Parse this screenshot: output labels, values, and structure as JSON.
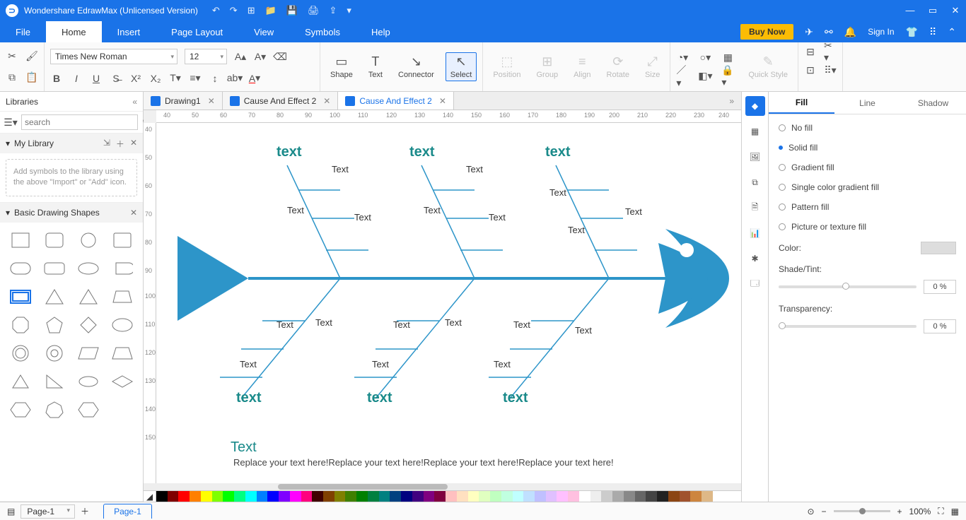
{
  "titlebar": {
    "app": "Wondershare EdrawMax (Unlicensed Version)"
  },
  "menu": {
    "items": [
      "File",
      "Home",
      "Insert",
      "Page Layout",
      "View",
      "Symbols",
      "Help"
    ],
    "active": 1,
    "buy": "Buy Now",
    "signin": "Sign In"
  },
  "ribbon": {
    "font": "Times New Roman",
    "size": "12",
    "tools": {
      "shape": "Shape",
      "text": "Text",
      "connector": "Connector",
      "select": "Select",
      "position": "Position",
      "group": "Group",
      "align": "Align",
      "rotate": "Rotate",
      "sizeb": "Size",
      "quick": "Quick Style"
    }
  },
  "left": {
    "title": "Libraries",
    "search_ph": "search",
    "mylib": "My Library",
    "note": "Add symbols to the library using the above \"Import\" or \"Add\" icon.",
    "shapes": "Basic Drawing Shapes"
  },
  "tabs": [
    {
      "label": "Drawing1",
      "active": false
    },
    {
      "label": "Cause And Effect 2",
      "active": false
    },
    {
      "label": "Cause And Effect 2",
      "active": true
    }
  ],
  "diagram": {
    "categories_top": [
      "text",
      "text",
      "text"
    ],
    "categories_bot": [
      "text",
      "text",
      "text"
    ],
    "sub": "Text",
    "title": "Text",
    "desc": "Replace your text here!Replace your text here!Replace your text here!Replace your text here!"
  },
  "rpanel": {
    "tabs": [
      "Fill",
      "Line",
      "Shadow"
    ],
    "active": 0,
    "opts": [
      "No fill",
      "Solid fill",
      "Gradient fill",
      "Single color gradient fill",
      "Pattern fill",
      "Picture or texture fill"
    ],
    "sel": 1,
    "color": "Color:",
    "shade": "Shade/Tint:",
    "trans": "Transparency:",
    "pc0": "0 %",
    "pc1": "0 %"
  },
  "status": {
    "page": "Page-1",
    "pagetab": "Page-1",
    "zoom": "100%"
  }
}
